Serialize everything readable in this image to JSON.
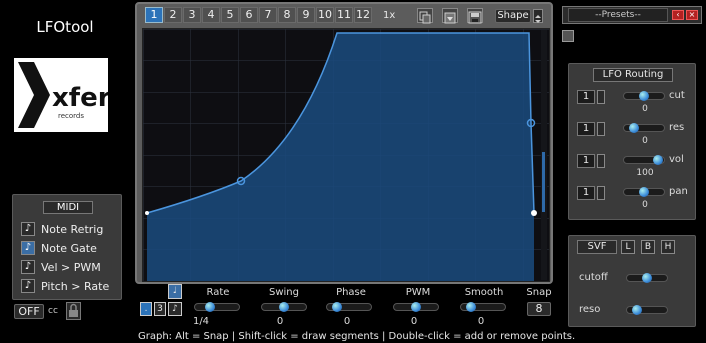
{
  "app": {
    "title": "LFOtool",
    "logo_text": "xfer"
  },
  "tabs": [
    "1",
    "2",
    "3",
    "4",
    "5",
    "6",
    "7",
    "8",
    "9",
    "10",
    "11",
    "12"
  ],
  "active_tab": "1",
  "toolbar": {
    "zoom": "1x",
    "shape_label": "Shape"
  },
  "midi": {
    "title": "MIDI",
    "items": [
      {
        "label": "Note Retrig",
        "on": false
      },
      {
        "label": "Note Gate",
        "on": true
      },
      {
        "label": "Vel > PWM",
        "on": false
      },
      {
        "label": "Pitch > Rate",
        "on": false
      }
    ],
    "cc_value": "OFF",
    "cc_label": "cc"
  },
  "controls": [
    {
      "label": "Rate",
      "value": "1/4",
      "knob_pos": 0.3
    },
    {
      "label": "Swing",
      "value": "0",
      "knob_pos": 0.5
    },
    {
      "label": "Phase",
      "value": "0",
      "knob_pos": 0.15
    },
    {
      "label": "PWM",
      "value": "0",
      "knob_pos": 0.5
    },
    {
      "label": "Smooth",
      "value": "0",
      "knob_pos": 0.15
    }
  ],
  "snap": {
    "label": "Snap",
    "value": "8"
  },
  "status": "Graph:   Alt = Snap | Shift-click = draw segments | Double-click = add or remove points.",
  "presets": {
    "label": "--Presets--"
  },
  "routing": {
    "title": "LFO Routing",
    "rows": [
      {
        "num": "1",
        "label": "cut",
        "value": "0",
        "knob_pos": 0.5
      },
      {
        "num": "1",
        "label": "res",
        "value": "0",
        "knob_pos": 0.15
      },
      {
        "num": "1",
        "label": "vol",
        "value": "100",
        "knob_pos": 0.95
      },
      {
        "num": "1",
        "label": "pan",
        "value": "0",
        "knob_pos": 0.5
      }
    ]
  },
  "svf": {
    "title": "SVF",
    "modes": [
      "L",
      "B",
      "H"
    ],
    "cutoff_label": "cutoff",
    "reso_label": "reso",
    "cutoff_pos": 0.5,
    "reso_pos": 0.15
  },
  "colors": {
    "accent": "#2c73b9",
    "curve": "#3b84d0",
    "fill": "#123a63"
  }
}
